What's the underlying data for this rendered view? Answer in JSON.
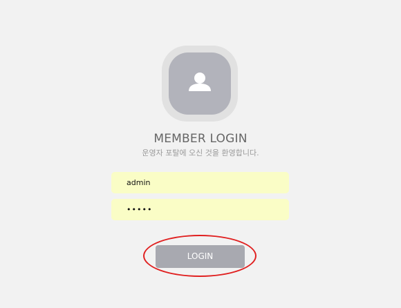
{
  "avatar": {
    "icon": "user-icon"
  },
  "header": {
    "title": "MEMBER LOGIN",
    "subtitle": "운영자 포탈에 오신 것을 환영합니다."
  },
  "form": {
    "username": "admin",
    "password": "•••••"
  },
  "login_button": {
    "label": "LOGIN"
  },
  "colors": {
    "background": "#f2f2f2",
    "avatar_outer": "#e1e1e1",
    "avatar_inner": "#b2b3bb",
    "input_bg": "#fafdc6",
    "button_bg": "#a8a9b0",
    "highlight": "#e02020"
  }
}
